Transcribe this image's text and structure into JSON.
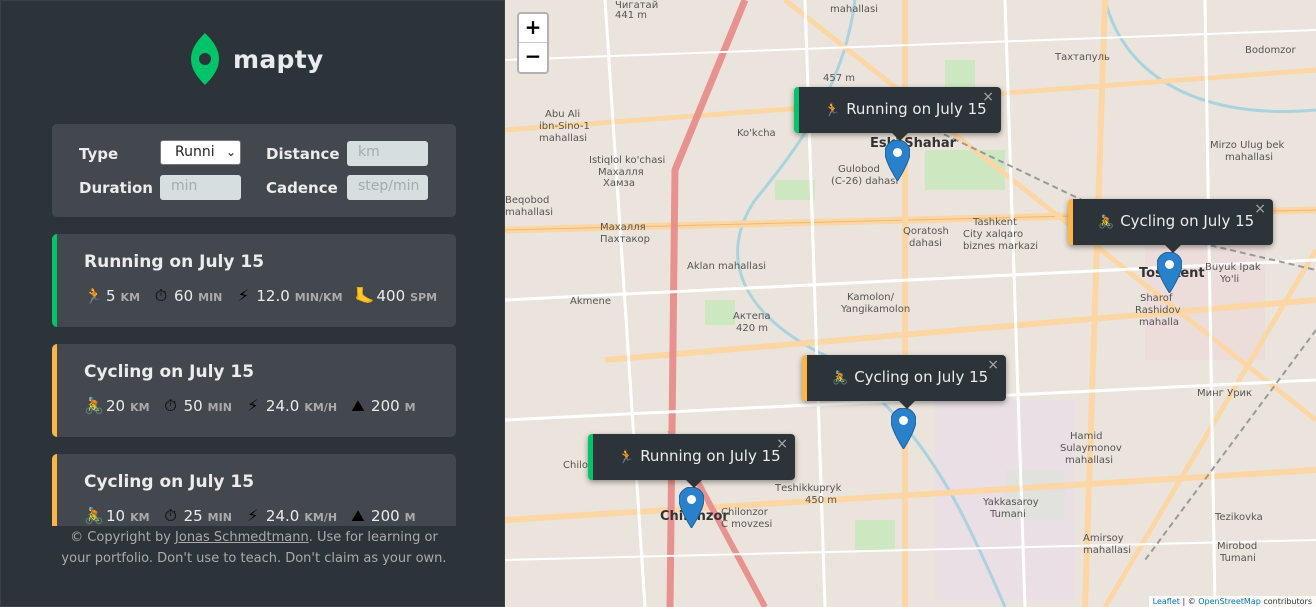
{
  "app": {
    "logo_text": "mapty",
    "brand_green": "#00c46a",
    "brand_yellow": "#ffb545"
  },
  "form": {
    "type_label": "Type",
    "type_value": "Runni",
    "distance_label": "Distance",
    "distance_placeholder": "km",
    "duration_label": "Duration",
    "duration_placeholder": "min",
    "cadence_label": "Cadence",
    "cadence_placeholder": "step/min"
  },
  "workouts": [
    {
      "title": "Running on July 15",
      "type": "running",
      "details": [
        {
          "icon": "🏃",
          "value": "5",
          "unit": "km"
        },
        {
          "icon": "⏱",
          "value": "60",
          "unit": "min"
        },
        {
          "icon": "⚡",
          "value": "12.0",
          "unit": "min/km"
        },
        {
          "icon": "🦶",
          "value": "400",
          "unit": "spm"
        }
      ]
    },
    {
      "title": "Cycling on July 15",
      "type": "cycling",
      "details": [
        {
          "icon": "🚴",
          "value": "20",
          "unit": "km"
        },
        {
          "icon": "⏱",
          "value": "50",
          "unit": "min"
        },
        {
          "icon": "⚡",
          "value": "24.0",
          "unit": "km/h"
        },
        {
          "icon": "⛰",
          "value": "200",
          "unit": "m"
        }
      ]
    },
    {
      "title": "Cycling on July 15",
      "type": "cycling",
      "details": [
        {
          "icon": "🚴",
          "value": "10",
          "unit": "km"
        },
        {
          "icon": "⏱",
          "value": "25",
          "unit": "min"
        },
        {
          "icon": "⚡",
          "value": "24.0",
          "unit": "km/h"
        },
        {
          "icon": "⛰",
          "value": "200",
          "unit": "m"
        }
      ]
    }
  ],
  "copyright": {
    "prefix": "© Copyright by ",
    "author": "Jonas Schmedtmann",
    "suffix": ". Use for learning or your portfolio. Don't use to teach. Don't claim as your own."
  },
  "map": {
    "zoom_in": "+",
    "zoom_out": "−",
    "popups": [
      {
        "label": "Running on July 15",
        "icon": "🏃",
        "type": "running"
      },
      {
        "label": "Cycling on July 15",
        "icon": "🚴",
        "type": "cycling"
      },
      {
        "label": "Cycling on July 15",
        "icon": "🚴",
        "type": "cycling"
      },
      {
        "label": "Running on July 15",
        "icon": "🏃",
        "type": "running"
      }
    ],
    "popup_close": "×",
    "labels": [
      "Чигатай",
      "441 m",
      "mahallasi",
      "457 m",
      "Eski Shahar",
      "Gulobod",
      "(C-26) dahasi",
      "Abu Ali",
      "ibn-Sino-1",
      "mahallasi",
      "Ko'kcha",
      "Istiqlol ko'chasi",
      "Махалля",
      "Хамза",
      "Beqobod",
      "mahallasi",
      "Махалля",
      "Пахтакор",
      "Aklan mahallasi",
      "Qoratosh",
      "dahasi",
      "Tashkent",
      "City xalqaro",
      "biznes markazi",
      "Toshkent",
      "Kamolon/",
      "Yangikamolon",
      "Актепа",
      "420 m",
      "Akmene",
      "Chilonzor",
      "Chilonzor",
      "C movzesi",
      "Теshikkuprуk",
      "450 m",
      "Hamid",
      "Sulaymonov",
      "mahallasi",
      "Yakkasaroy",
      "Tumani",
      "Amirsoy",
      "mahallasi",
      "Mirobod",
      "Tumani",
      "Tezikovka",
      "Минг Урик",
      "Sharof",
      "Rashidov",
      "mahalla",
      "Mirzo Ulug bek",
      "mahallasi",
      "Bodomzor",
      "Тахтапуль",
      "Buyuk Ipak",
      "Yo'li",
      "Chilonzor 23 m"
    ],
    "attribution_leaflet": "Leaflet",
    "attribution_sep": " | © ",
    "attribution_osm": "OpenStreetMap",
    "attribution_suffix": " contributors"
  }
}
